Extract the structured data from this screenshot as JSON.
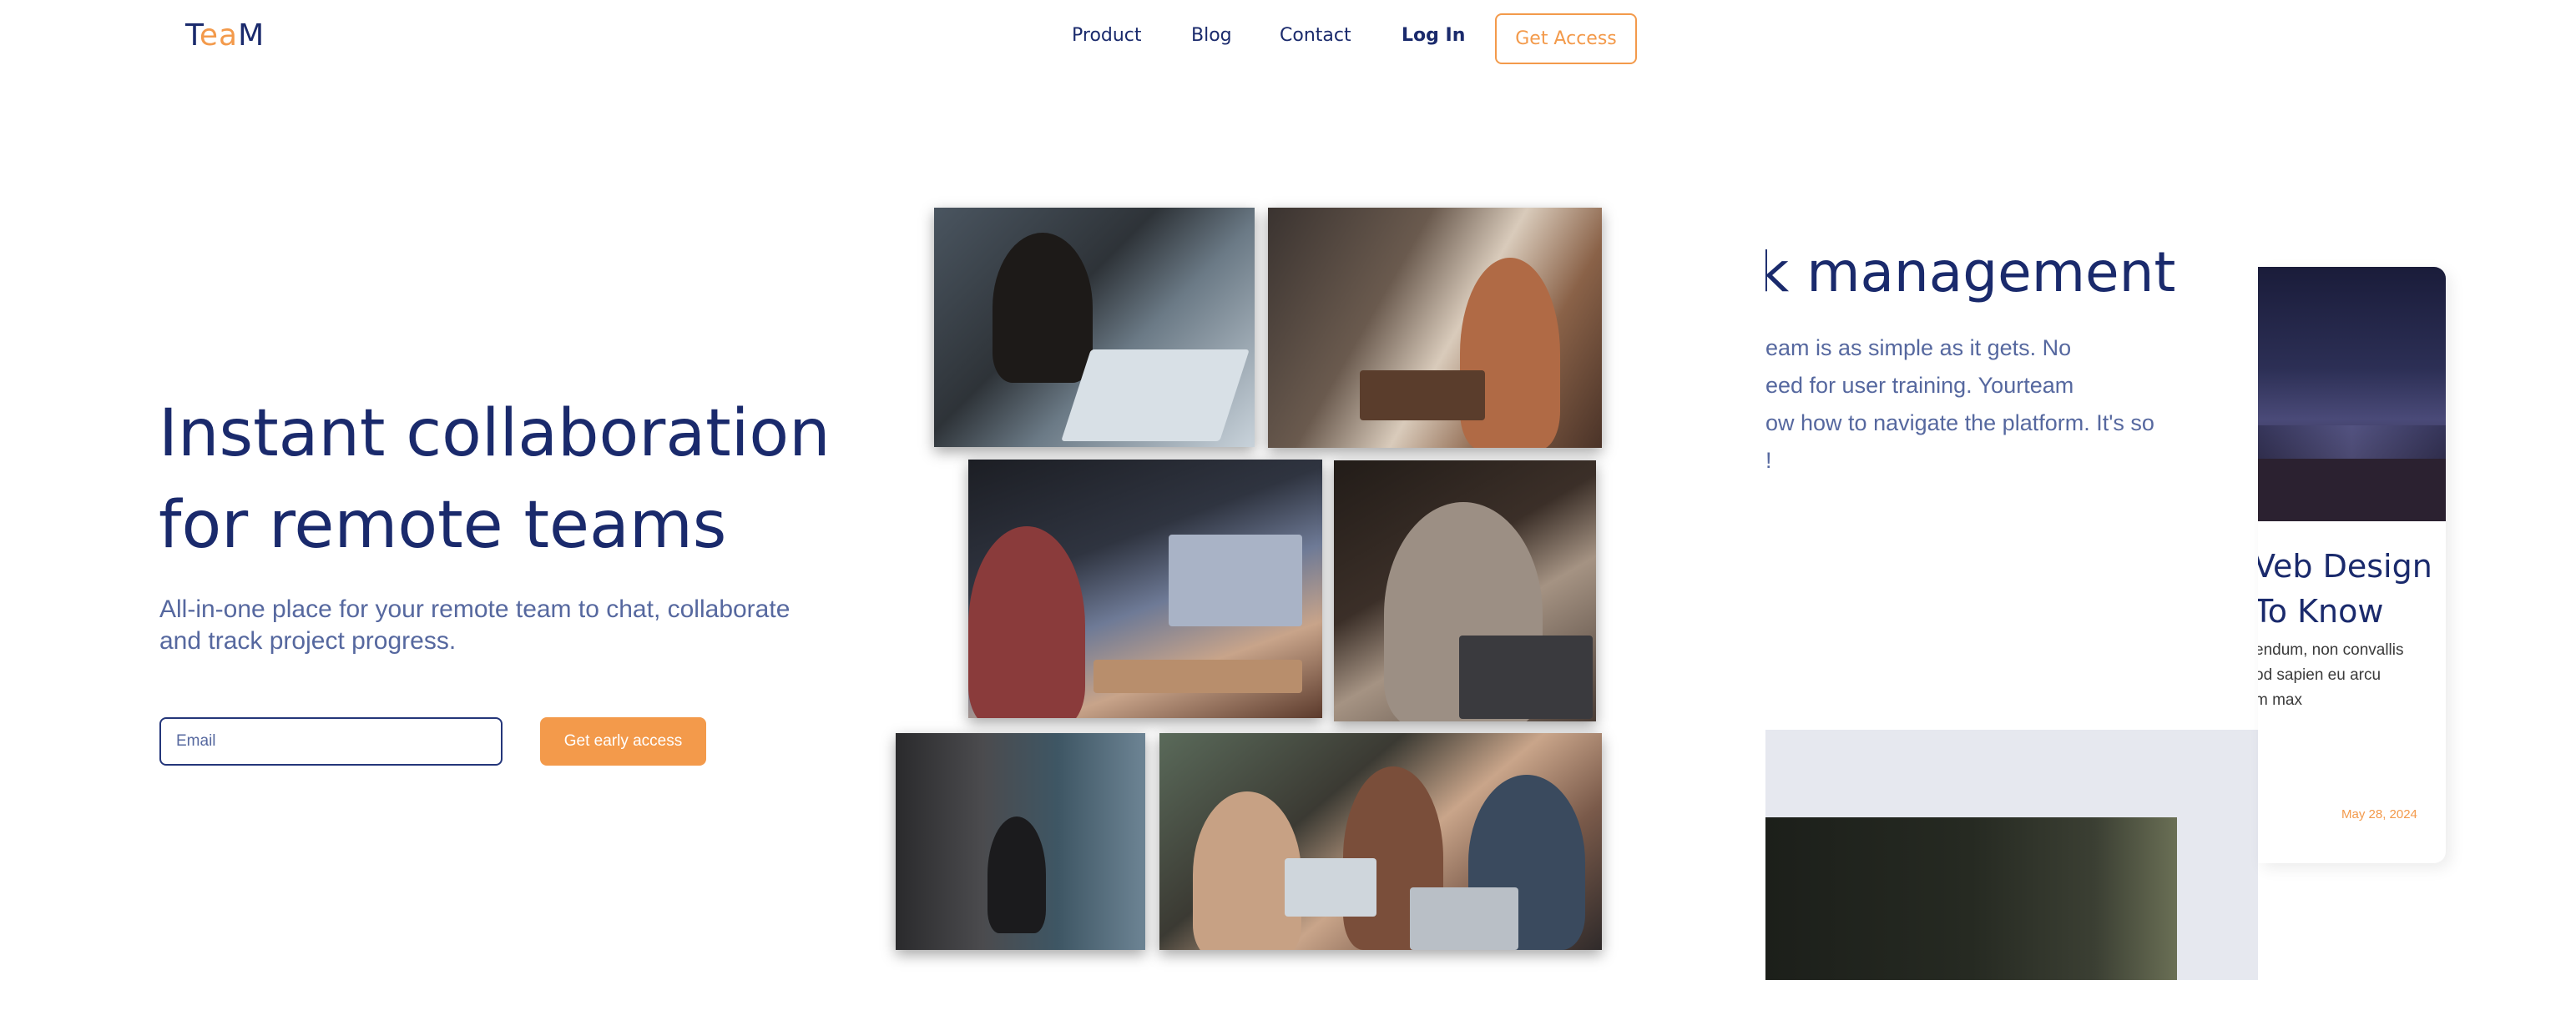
{
  "logo": {
    "part1": "T",
    "part2": "ea",
    "part3": "M"
  },
  "nav": {
    "items": [
      {
        "label": "Product"
      },
      {
        "label": "Blog"
      },
      {
        "label": "Contact"
      }
    ],
    "login_label": "Log In",
    "cta_label": "Get Access"
  },
  "hero": {
    "title_line1": "Instant collaboration",
    "title_line2": "for remote teams",
    "subtitle_line1": "All-in-one place for your remote team to chat, collaborate",
    "subtitle_line2": "and track project progress.",
    "email_placeholder": "Email",
    "button_label": "Get early access"
  },
  "feature": {
    "title": "k management",
    "lines": [
      "eam is as simple as it gets. No",
      "eed for user training. Yourteam",
      "ow how to navigate the platform. It's so",
      "!"
    ]
  },
  "blog_card": {
    "title_line1": "Veb Design",
    "title_line2": " To Know",
    "text_lines": [
      "endum, non convallis",
      "od sapien eu arcu",
      "m max"
    ],
    "date": "May 28, 2024"
  },
  "colors": {
    "primary": "#1a2a6c",
    "accent": "#f39a4b",
    "muted": "#56689f"
  }
}
